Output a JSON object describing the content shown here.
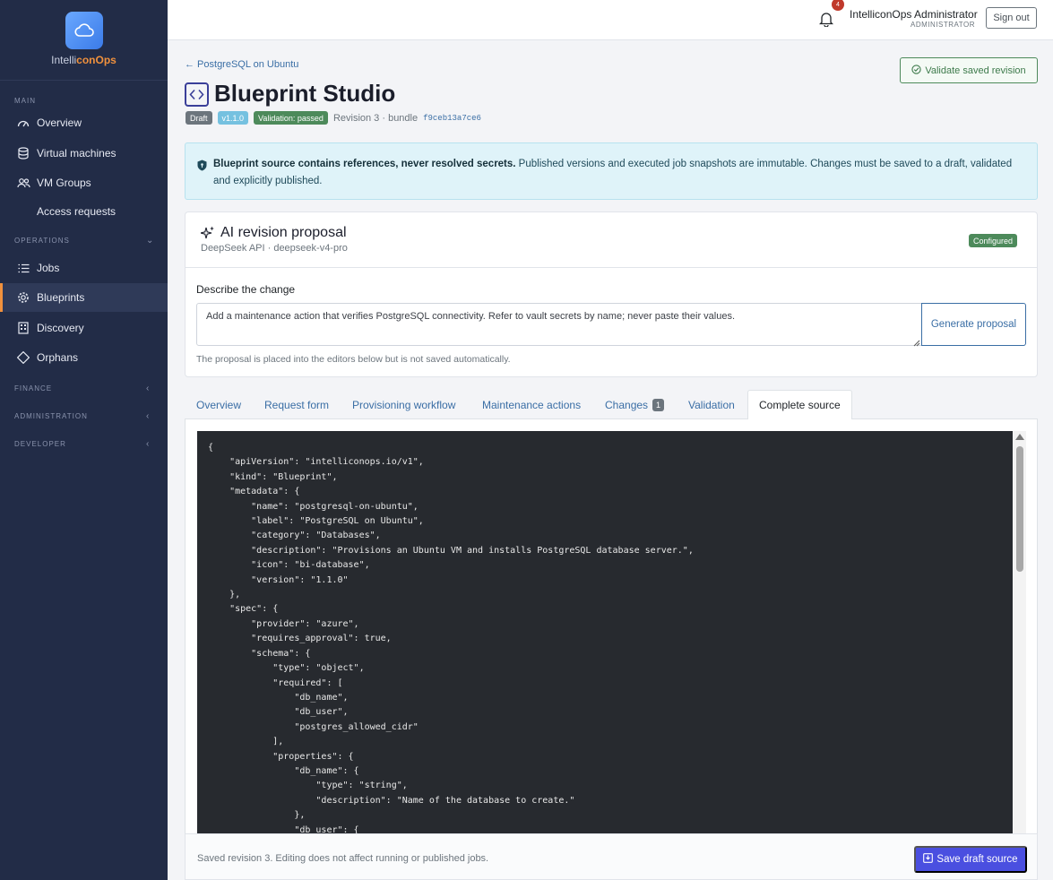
{
  "brand": {
    "name_part1": "Intelli",
    "name_part2": "conOps"
  },
  "sidebar": {
    "sections": {
      "main": "MAIN",
      "operations": "OPERATIONS",
      "finance": "FINANCE",
      "administration": "ADMINISTRATION",
      "developer": "DEVELOPER"
    },
    "items": [
      {
        "label": "Overview",
        "icon": "speedometer-icon"
      },
      {
        "label": "Virtual machines",
        "icon": "database-icon"
      },
      {
        "label": "VM Groups",
        "icon": "people-icon"
      },
      {
        "label": "Access requests",
        "icon": ""
      },
      {
        "label": "Jobs",
        "icon": "list-icon"
      },
      {
        "label": "Blueprints",
        "icon": "gear-icon"
      },
      {
        "label": "Discovery",
        "icon": "building-icon"
      },
      {
        "label": "Orphans",
        "icon": "diamond-icon"
      }
    ],
    "active": "Blueprints"
  },
  "topbar": {
    "notification_count": "4",
    "user_name": "IntelliconOps Administrator",
    "user_role": "ADMINISTRATOR",
    "signout_label": "Sign out"
  },
  "header": {
    "back_link": "← PostgreSQL on Ubuntu",
    "title": "Blueprint Studio",
    "validate_label": "Validate saved revision",
    "badges": {
      "status": "Draft",
      "version": "v1.1.0",
      "validation": "Validation: passed"
    },
    "revision_text": "Revision 3 · bundle",
    "bundle_hash": "f9ceb13a7ce6"
  },
  "alert": {
    "bold": "Blueprint source contains references, never resolved secrets.",
    "text": " Published versions and executed job snapshots are immutable. Changes must be saved to a draft, validated and explicitly published."
  },
  "ai": {
    "title": "AI revision proposal",
    "subtitle": "DeepSeek API · deepseek-v4-pro",
    "status": "Configured",
    "describe_label": "Describe the change",
    "prompt_value": "Add a maintenance action that verifies PostgreSQL connectivity. Refer to vault secrets by name; never paste their values.",
    "generate_label": "Generate proposal",
    "note": "The proposal is placed into the editors below but is not saved automatically."
  },
  "tabs": [
    {
      "label": "Overview"
    },
    {
      "label": "Request form"
    },
    {
      "label": "Provisioning workflow"
    },
    {
      "label": "Maintenance actions"
    },
    {
      "label": "Changes",
      "count": "1"
    },
    {
      "label": "Validation"
    },
    {
      "label": "Complete source"
    }
  ],
  "active_tab": "Complete source",
  "editor": {
    "source": "{\n    \"apiVersion\": \"intelliconops.io/v1\",\n    \"kind\": \"Blueprint\",\n    \"metadata\": {\n        \"name\": \"postgresql-on-ubuntu\",\n        \"label\": \"PostgreSQL on Ubuntu\",\n        \"category\": \"Databases\",\n        \"description\": \"Provisions an Ubuntu VM and installs PostgreSQL database server.\",\n        \"icon\": \"bi-database\",\n        \"version\": \"1.1.0\"\n    },\n    \"spec\": {\n        \"provider\": \"azure\",\n        \"requires_approval\": true,\n        \"schema\": {\n            \"type\": \"object\",\n            \"required\": [\n                \"db_name\",\n                \"db_user\",\n                \"postgres_allowed_cidr\"\n            ],\n            \"properties\": {\n                \"db_name\": {\n                    \"type\": \"string\",\n                    \"description\": \"Name of the database to create.\"\n                },\n                \"db_user\": {"
  },
  "footer": {
    "note": "Saved revision 3. Editing does not affect running or published jobs.",
    "save_label": "Save draft source"
  }
}
